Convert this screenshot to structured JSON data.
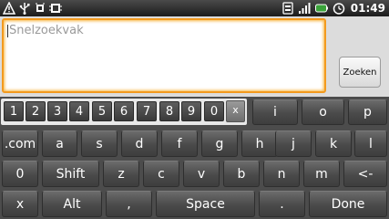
{
  "status_bar": {
    "time": "01:49",
    "left_icons": [
      "warning-icon",
      "usb-icon",
      "usb-debug-icon",
      "sd-card-icon"
    ],
    "right_icons": [
      "sim-icon",
      "signal-icon",
      "battery-icon",
      "alarm-icon"
    ]
  },
  "search": {
    "placeholder": "Snelzoekvak",
    "value": "",
    "button_label": "Zoeken"
  },
  "keyboard": {
    "numbers": [
      "1",
      "2",
      "3",
      "4",
      "5",
      "6",
      "7",
      "8",
      "9",
      "0"
    ],
    "numbers_close": "x",
    "row1_letters": [
      "i",
      "o",
      "p"
    ],
    "row2": [
      ".com",
      "a",
      "s",
      "d",
      "f",
      "g",
      "h",
      "j",
      "k",
      "l"
    ],
    "row3": [
      "0",
      "Shift",
      "z",
      "c",
      "v",
      "b",
      "n",
      "m",
      "<-"
    ],
    "row4": [
      "x",
      "Alt",
      ",",
      "Space",
      ".",
      "Done"
    ]
  },
  "colors": {
    "focus_border": "#f39a1e",
    "key_bg": "#4a4a4a",
    "keyboard_bg": "#4c4c4c"
  }
}
